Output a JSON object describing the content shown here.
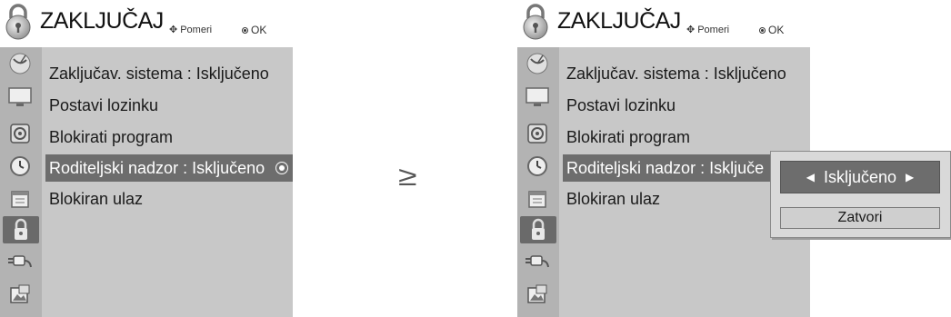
{
  "left_panel": {
    "title": "ZAKLJUČAJ",
    "hint_move": "Pomeri",
    "hint_ok": "OK",
    "items": [
      {
        "label": "Zaključav. sistema : Isključeno"
      },
      {
        "label": "Postavi lozinku"
      },
      {
        "label": "Blokirati program"
      },
      {
        "label": "Roditeljski nadzor  : Isključeno"
      },
      {
        "label": "Blokiran ulaz"
      }
    ],
    "selected_index": 3
  },
  "separator": "≥",
  "right_panel": {
    "title": "ZAKLJUČAJ",
    "hint_move": "Pomeri",
    "hint_ok": "OK",
    "items": [
      {
        "label": "Zaključav. sistema : Isključeno"
      },
      {
        "label": "Postavi lozinku"
      },
      {
        "label": "Blokirati program"
      },
      {
        "label": "Roditeljski nadzor  : Isključe"
      },
      {
        "label": "Blokiran ulaz"
      }
    ],
    "selected_index": 3,
    "popup": {
      "value": "Isključeno",
      "close_label": "Zatvori"
    }
  },
  "sidebar_icons": [
    "satellite-dish-icon",
    "tv-screen-icon",
    "speaker-icon",
    "clock-icon",
    "calendar-icon",
    "lock-icon",
    "plug-icon",
    "photo-icon"
  ],
  "active_sidebar_icon": "lock-icon"
}
